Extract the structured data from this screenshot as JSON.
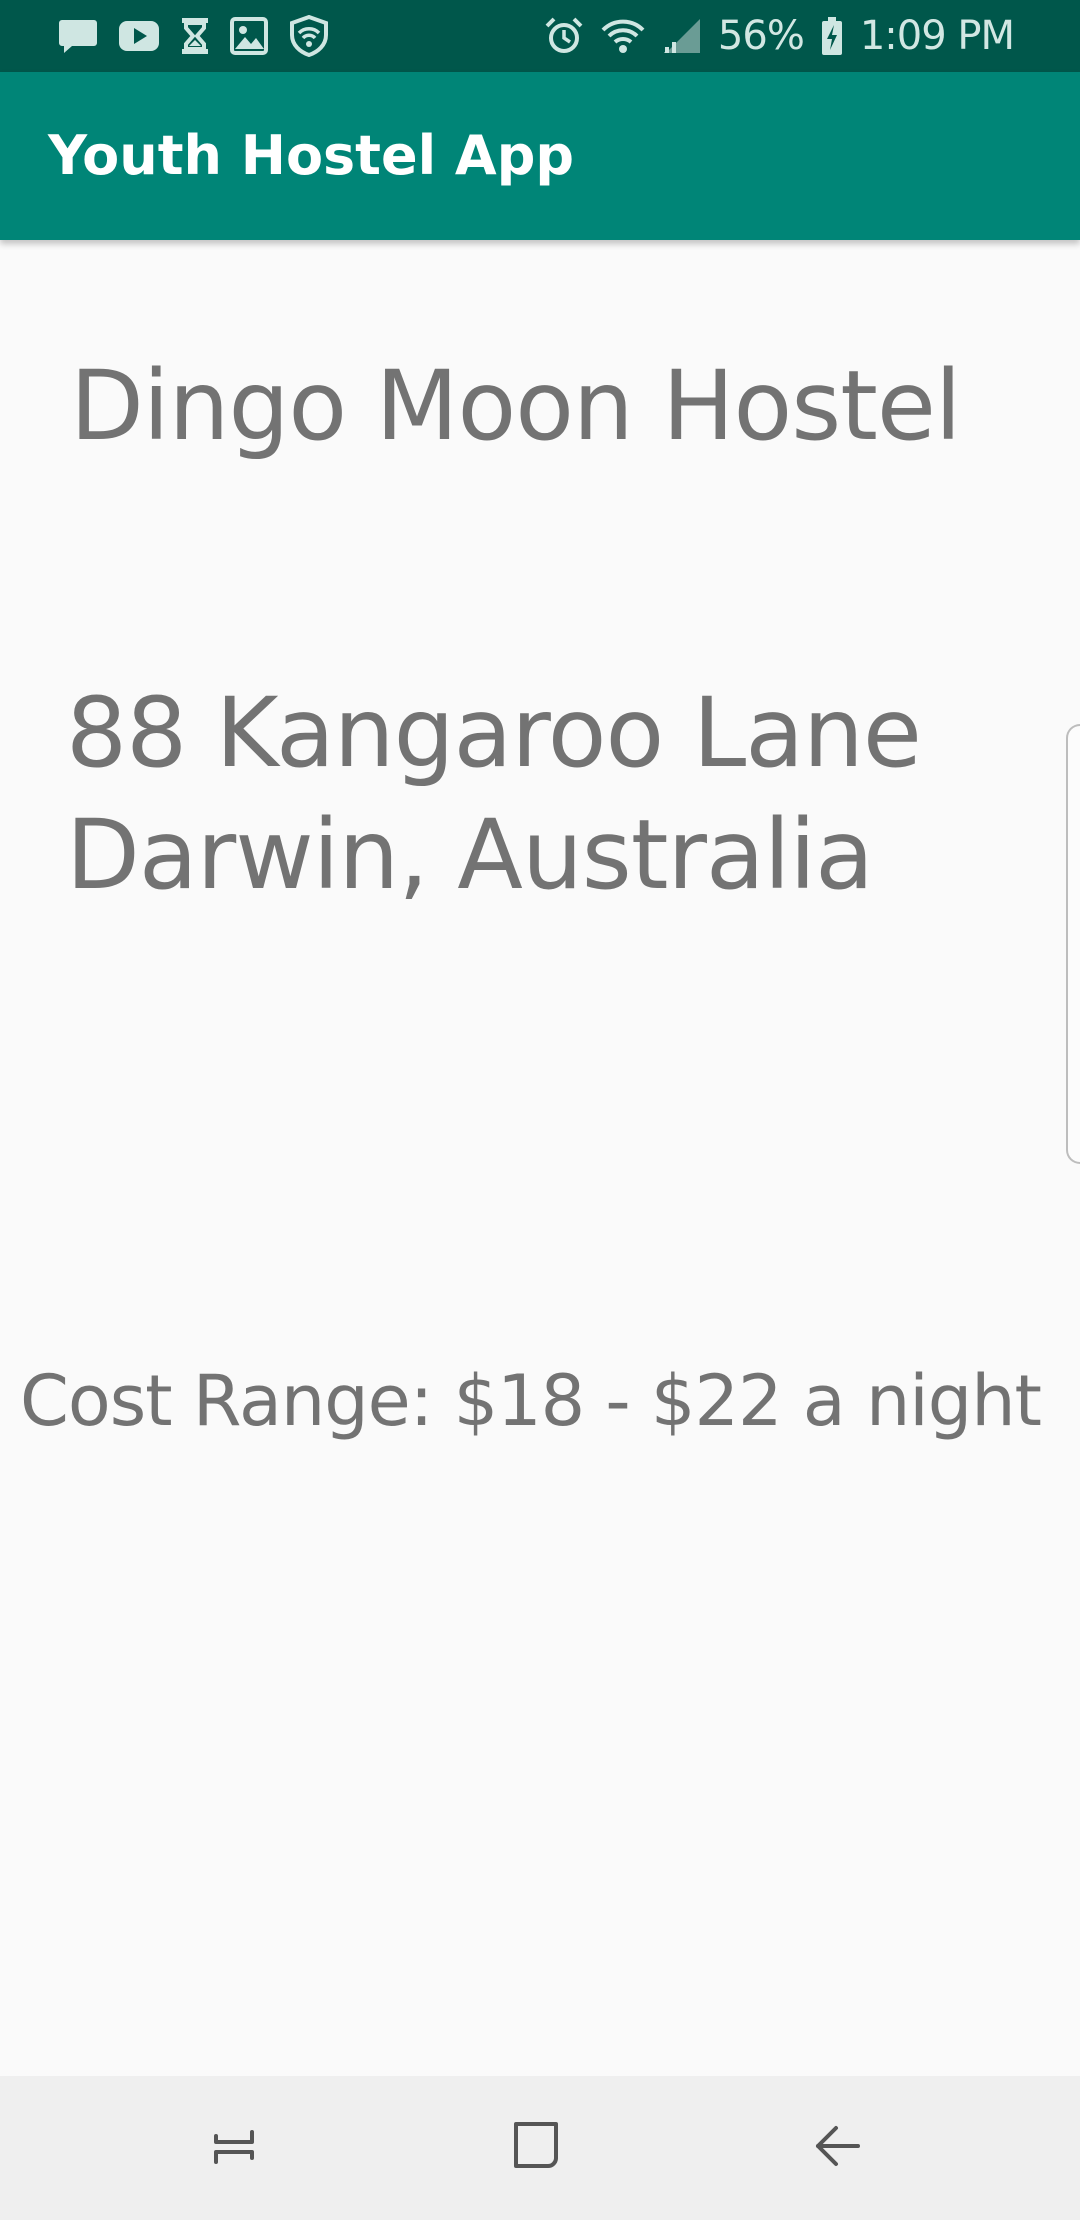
{
  "status_bar": {
    "left_icons": [
      "message-icon",
      "youtube-icon",
      "hourglass-icon",
      "image-icon",
      "shield-wifi-icon"
    ],
    "right_icons": [
      "alarm-icon",
      "wifi-icon",
      "signal-icon",
      "battery-charging-icon"
    ],
    "battery_percent": "56%",
    "time": "1:09 PM"
  },
  "app_bar": {
    "title": "Youth Hostel App"
  },
  "hostel": {
    "name": "Dingo Moon Hostel",
    "address_line1": "88 Kangaroo Lane",
    "address_line2": "Darwin, Australia",
    "cost": "Cost Range: $18 - $22 a night"
  },
  "nav_bar": {
    "buttons": [
      "recent-apps-icon",
      "home-icon",
      "back-icon"
    ]
  },
  "colors": {
    "status_bar": "#00574b",
    "app_bar": "#008577",
    "background": "#fafafa",
    "text": "#737373",
    "nav_bar": "#efefef"
  }
}
